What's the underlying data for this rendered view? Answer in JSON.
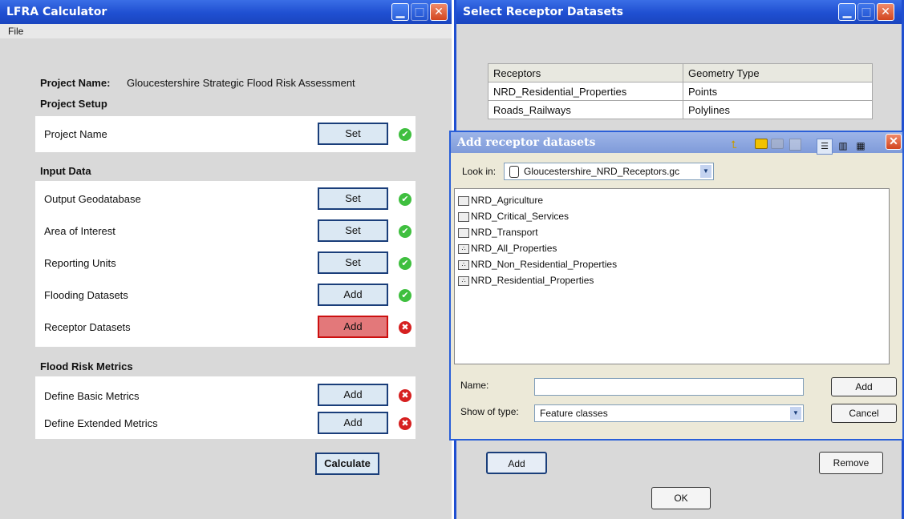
{
  "lfra": {
    "title": "LFRA Calculator",
    "menu_file": "File",
    "project_name_label": "Project Name:",
    "project_name_value": "Gloucestershire Strategic Flood Risk Assessment",
    "sections": {
      "project_setup": "Project Setup",
      "input_data": "Input Data",
      "flood_risk_metrics": "Flood Risk Metrics"
    },
    "rows": {
      "project_name": {
        "label": "Project Name",
        "button": "Set"
      },
      "output_geodatabase": {
        "label": "Output Geodatabase",
        "button": "Set"
      },
      "area_of_interest": {
        "label": "Area of Interest",
        "button": "Set"
      },
      "reporting_units": {
        "label": "Reporting Units",
        "button": "Set"
      },
      "flooding_datasets": {
        "label": "Flooding Datasets",
        "button": "Add"
      },
      "receptor_datasets": {
        "label": "Receptor Datasets",
        "button": "Add"
      },
      "basic_metrics": {
        "label": "Define Basic Metrics",
        "button": "Add"
      },
      "extended_metrics": {
        "label": "Define Extended Metrics",
        "button": "Add"
      }
    },
    "status_icons": {
      "ok": "✔",
      "error": "✖"
    },
    "calculate_label": "Calculate"
  },
  "select_receptors": {
    "title": "Select Receptor Datasets",
    "table": {
      "headers": [
        "Receptors",
        "Geometry Type"
      ],
      "rows": [
        [
          "NRD_Residential_Properties",
          "Points"
        ],
        [
          "Roads_Railways",
          "Polylines"
        ]
      ]
    },
    "add_label": "Add",
    "remove_label": "Remove",
    "ok_label": "OK"
  },
  "add_dialog": {
    "title": "Add receptor datasets",
    "look_in_label": "Look in:",
    "look_in_value": "Gloucestershire_NRD_Receptors.gc",
    "items": [
      {
        "name": "NRD_Agriculture",
        "icon": "polygon-feature-class-icon"
      },
      {
        "name": "NRD_Critical_Services",
        "icon": "polygon-feature-class-icon"
      },
      {
        "name": "NRD_Transport",
        "icon": "polygon-feature-class-icon"
      },
      {
        "name": "NRD_All_Properties",
        "icon": "point-feature-class-icon"
      },
      {
        "name": "NRD_Non_Residential_Properties",
        "icon": "point-feature-class-icon"
      },
      {
        "name": "NRD_Residential_Properties",
        "icon": "point-feature-class-icon"
      }
    ],
    "name_label": "Name:",
    "name_value": "",
    "show_type_label": "Show of type:",
    "show_type_value": "Feature classes",
    "add_label": "Add",
    "cancel_label": "Cancel"
  },
  "glyphs": {
    "minimize": "▁",
    "maximize": "□",
    "close": "✕",
    "dropdown": "▼",
    "up": "⮤"
  }
}
